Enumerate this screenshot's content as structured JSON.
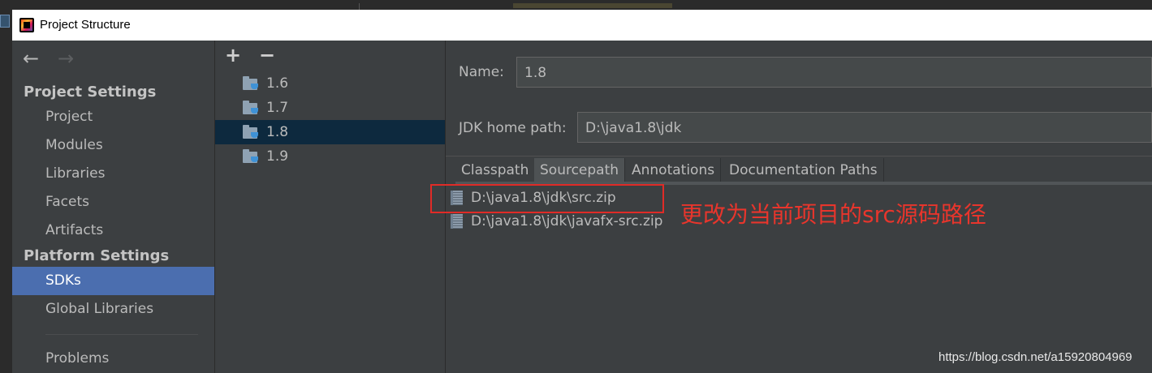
{
  "window": {
    "title": "Project Structure"
  },
  "nav": {
    "back_icon": "←",
    "forward_icon": "→"
  },
  "sidebar": {
    "project_settings_heading": "Project Settings",
    "project_items": [
      {
        "label": "Project"
      },
      {
        "label": "Modules"
      },
      {
        "label": "Libraries"
      },
      {
        "label": "Facets"
      },
      {
        "label": "Artifacts"
      }
    ],
    "platform_settings_heading": "Platform Settings",
    "platform_items": [
      {
        "label": "SDKs",
        "selected": true
      },
      {
        "label": "Global Libraries"
      }
    ],
    "problems_label": "Problems"
  },
  "sdk_list": {
    "add_label": "+",
    "remove_label": "−",
    "items": [
      {
        "label": "1.6"
      },
      {
        "label": "1.7"
      },
      {
        "label": "1.8",
        "selected": true
      },
      {
        "label": "1.9"
      }
    ]
  },
  "details": {
    "name_label": "Name:",
    "name_value": "1.8",
    "jdk_home_label": "JDK home path:",
    "jdk_home_value": "D:\\java1.8\\jdk",
    "tabs": [
      {
        "label": "Classpath"
      },
      {
        "label": "Sourcepath",
        "selected": true
      },
      {
        "label": "Annotations"
      },
      {
        "label": "Documentation Paths"
      }
    ],
    "sourcepaths": [
      {
        "path": "D:\\java1.8\\jdk\\src.zip"
      },
      {
        "path": "D:\\java1.8\\jdk\\javafx-src.zip"
      }
    ]
  },
  "annotation": {
    "text": "更改为当前项目的src源码路径",
    "color": "#e8352c"
  },
  "watermark": "https://blog.csdn.net/a15920804969",
  "colors": {
    "background": "#3c3f41",
    "selection_blue": "#4b6eaf",
    "list_selection": "#0d293e",
    "annotation_red": "#e02b27"
  }
}
